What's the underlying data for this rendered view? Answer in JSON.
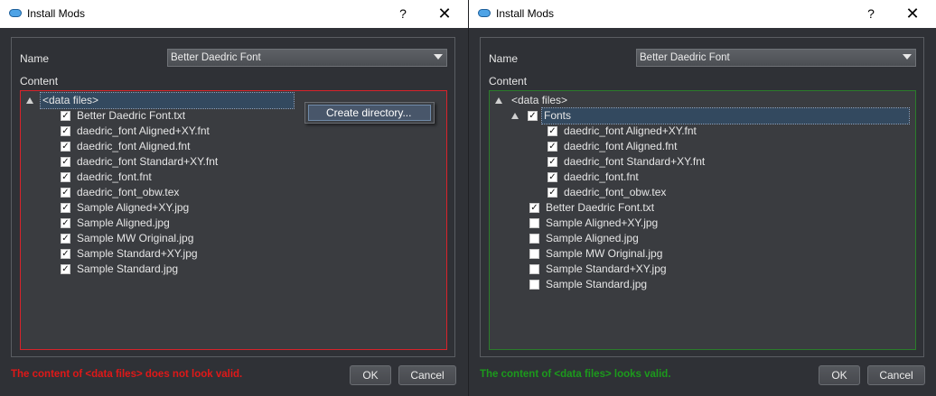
{
  "left": {
    "title": "Install Mods",
    "help": "?",
    "close": "✕",
    "name_label": "Name",
    "name_value": "Better Daedric Font",
    "content_label": "Content",
    "root": "<data files>",
    "items": [
      "Better Daedric Font.txt",
      "daedric_font Aligned+XY.fnt",
      "daedric_font Aligned.fnt",
      "daedric_font Standard+XY.fnt",
      "daedric_font.fnt",
      "daedric_font_obw.tex",
      "Sample Aligned+XY.jpg",
      "Sample Aligned.jpg",
      "Sample MW Original.jpg",
      "Sample Standard+XY.jpg",
      "Sample Standard.jpg"
    ],
    "context_menu_item": "Create directory...",
    "status": "The content of <data files> does not look valid.",
    "ok": "OK",
    "cancel": "Cancel",
    "status_color": "#e01818"
  },
  "right": {
    "title": "Install Mods",
    "help": "?",
    "close": "✕",
    "name_label": "Name",
    "name_value": "Better Daedric Font",
    "content_label": "Content",
    "root": "<data files>",
    "folder": "Fonts",
    "folder_items": [
      "daedric_font Aligned+XY.fnt",
      "daedric_font Aligned.fnt",
      "daedric_font Standard+XY.fnt",
      "daedric_font.fnt",
      "daedric_font_obw.tex"
    ],
    "items_checked": [
      "Better Daedric Font.txt"
    ],
    "items_unchecked": [
      "Sample Aligned+XY.jpg",
      "Sample Aligned.jpg",
      "Sample MW Original.jpg",
      "Sample Standard+XY.jpg",
      "Sample Standard.jpg"
    ],
    "status": "The content of <data files> looks valid.",
    "ok": "OK",
    "cancel": "Cancel",
    "status_color": "#1c9a1c"
  }
}
